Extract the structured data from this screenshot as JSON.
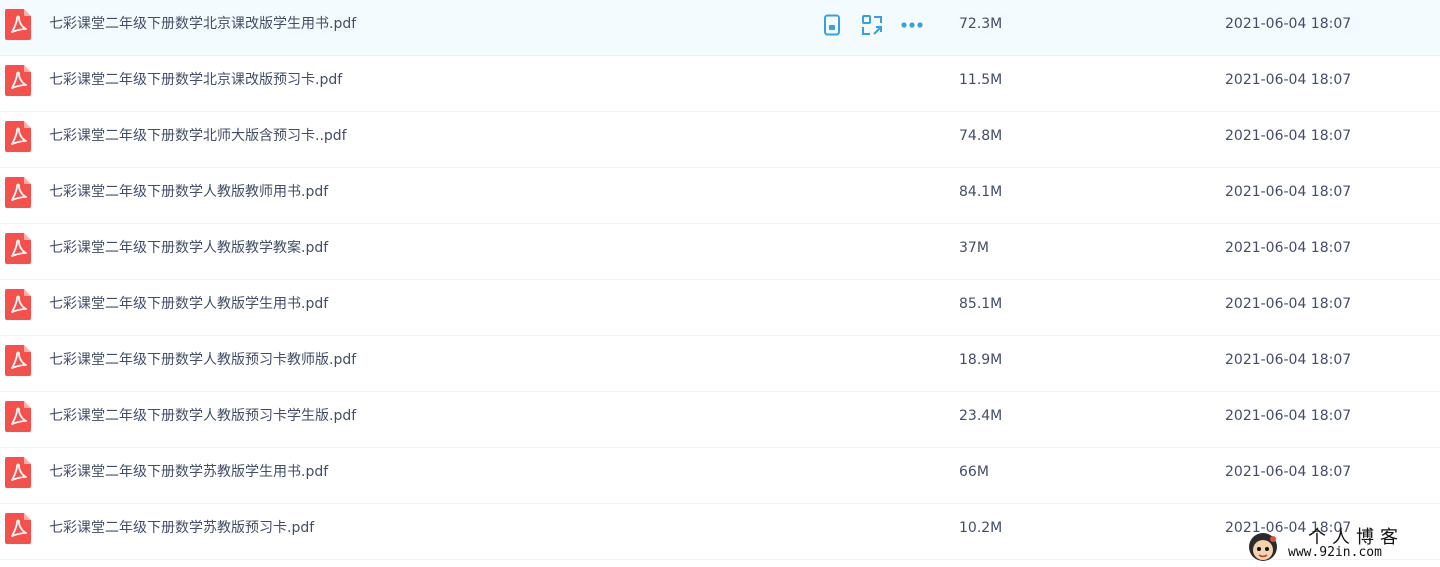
{
  "colors": {
    "pdf_icon": "#f6504d",
    "action_icon": "#3a9fe0",
    "row_hover_bg": "#f4fbff",
    "text": "#424e67"
  },
  "row_icon": "pdf-icon",
  "hover_actions": [
    {
      "icon": "phone-icon"
    },
    {
      "icon": "share-icon"
    },
    {
      "icon": "more-icon"
    }
  ],
  "files": [
    {
      "name": "七彩课堂二年级下册数学北京课改版学生用书.pdf",
      "size": "72.3M",
      "date": "2021-06-04 18:07"
    },
    {
      "name": "七彩课堂二年级下册数学北京课改版预习卡.pdf",
      "size": "11.5M",
      "date": "2021-06-04 18:07"
    },
    {
      "name": "七彩课堂二年级下册数学北师大版含预习卡..pdf",
      "size": "74.8M",
      "date": "2021-06-04 18:07"
    },
    {
      "name": "七彩课堂二年级下册数学人教版教师用书.pdf",
      "size": "84.1M",
      "date": "2021-06-04 18:07"
    },
    {
      "name": "七彩课堂二年级下册数学人教版教学教案.pdf",
      "size": "37M",
      "date": "2021-06-04 18:07"
    },
    {
      "name": "七彩课堂二年级下册数学人教版学生用书.pdf",
      "size": "85.1M",
      "date": "2021-06-04 18:07"
    },
    {
      "name": "七彩课堂二年级下册数学人教版预习卡教师版.pdf",
      "size": "18.9M",
      "date": "2021-06-04 18:07"
    },
    {
      "name": "七彩课堂二年级下册数学人教版预习卡学生版.pdf",
      "size": "23.4M",
      "date": "2021-06-04 18:07"
    },
    {
      "name": "七彩课堂二年级下册数学苏教版学生用书.pdf",
      "size": "66M",
      "date": "2021-06-04 18:07"
    },
    {
      "name": "七彩课堂二年级下册数学苏教版预习卡.pdf",
      "size": "10.2M",
      "date": "2021-06-04 18:07"
    }
  ],
  "watermark": {
    "title": "个人博客",
    "url": "www.92in.com"
  }
}
